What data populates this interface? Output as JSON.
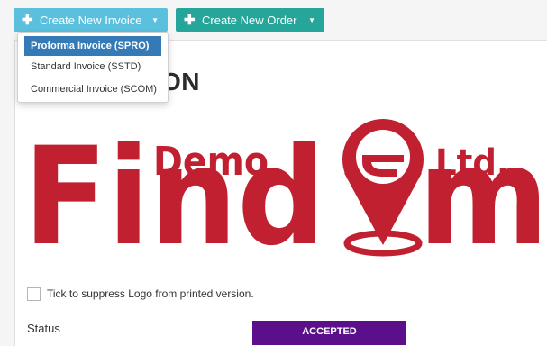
{
  "toolbar": {
    "create_invoice_label": "Create New Invoice",
    "create_order_label": "Create New Order",
    "plus_icon": "plus-icon",
    "caret_icon": "caret-down-icon"
  },
  "invoice_menu": {
    "items": [
      {
        "label": "Proforma Invoice (SPRO)",
        "active": true
      },
      {
        "label": "Standard Invoice (SSTD)",
        "active": false
      },
      {
        "label": "Commercial Invoice (SCOM)",
        "active": false
      }
    ]
  },
  "page": {
    "heading_visible": "ON"
  },
  "logo": {
    "word_main": "Find",
    "word_end": "m",
    "word_demo": "Demo",
    "word_ltd": "Ltd.",
    "color": "#c0202f"
  },
  "logo_option": {
    "label": "Tick to suppress Logo from printed version.",
    "checked": false
  },
  "status": {
    "label": "Status",
    "value": "ACCEPTED",
    "color": "#5c0f8b"
  },
  "colors": {
    "invoice_button": "#5bc0de",
    "order_button": "#26a69a",
    "menu_active": "#337ab7"
  }
}
